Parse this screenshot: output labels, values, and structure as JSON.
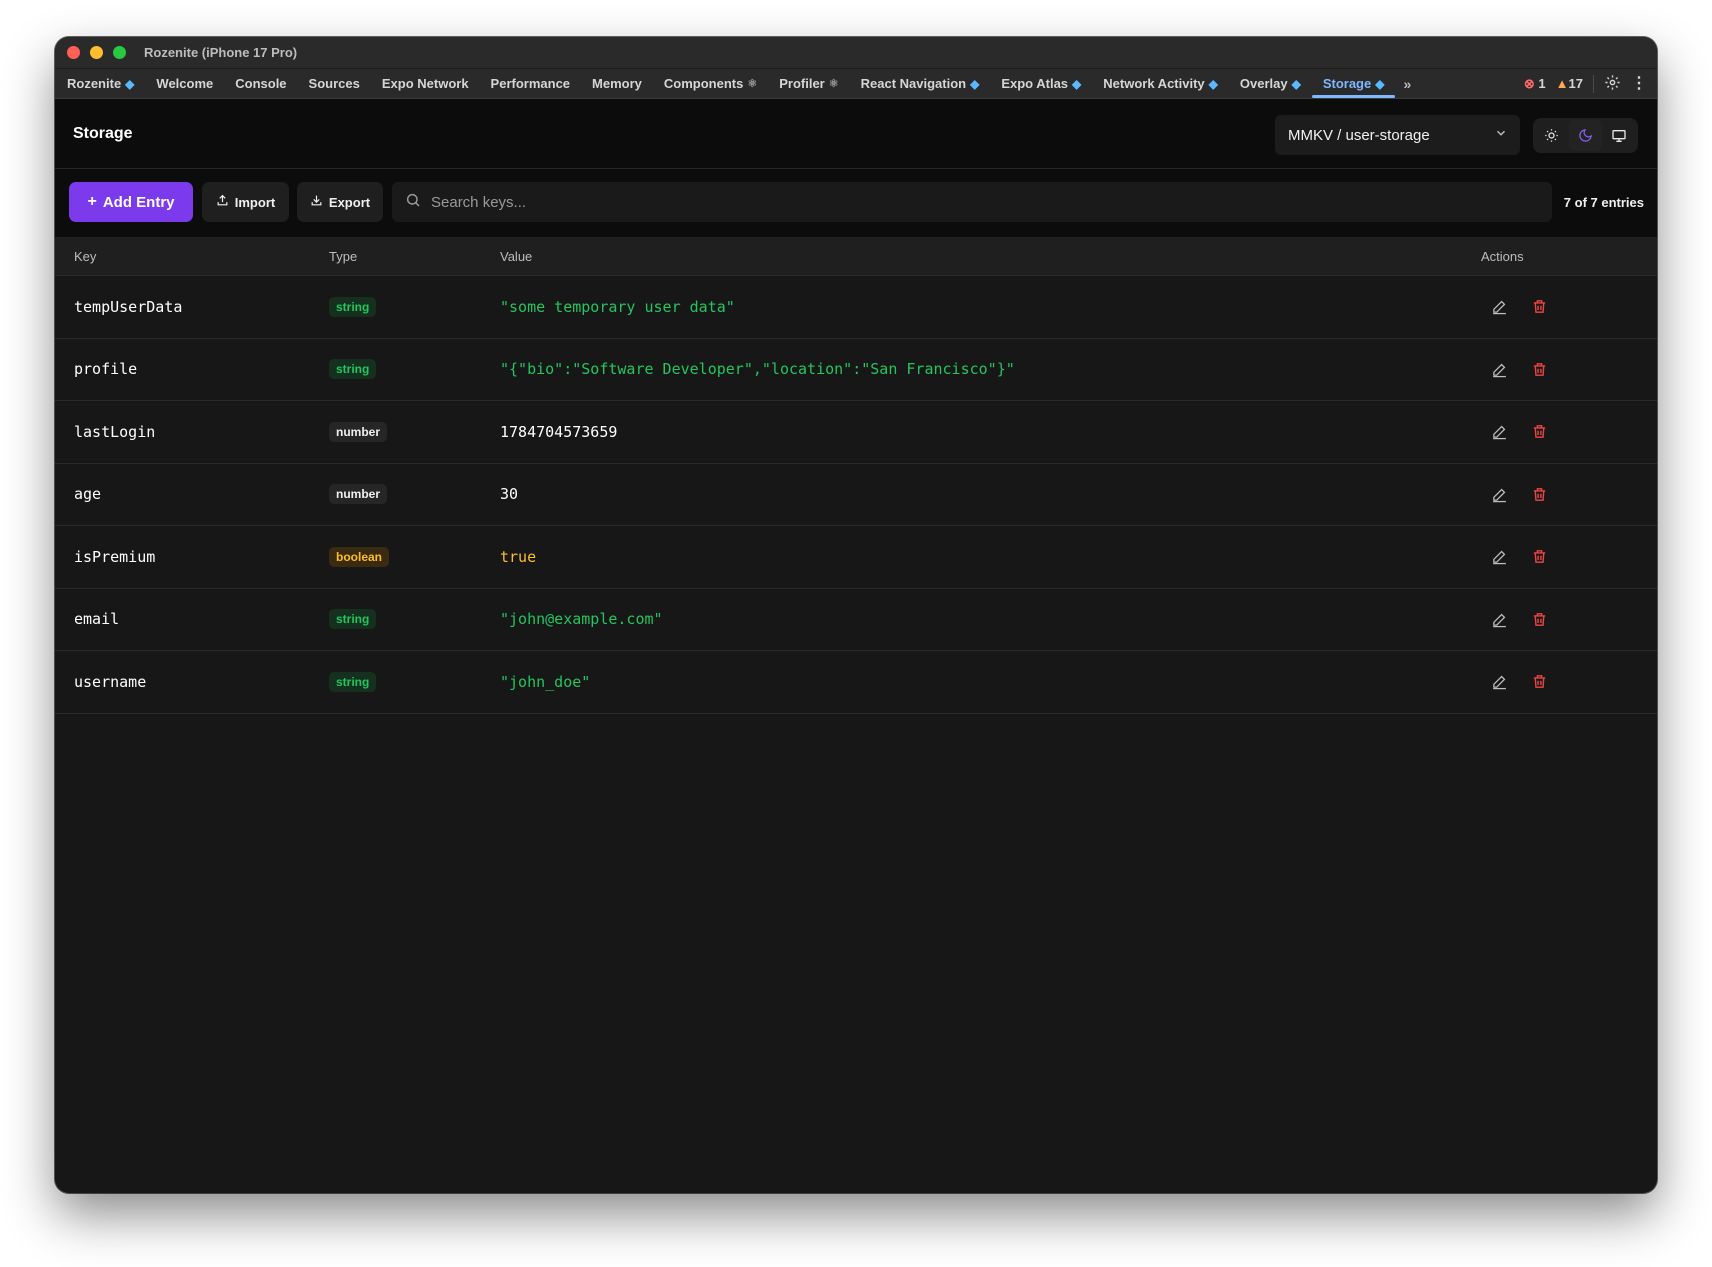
{
  "window": {
    "title": "Rozenite (iPhone 17 Pro)"
  },
  "tabs": [
    {
      "label": "Rozenite",
      "badge": "gem"
    },
    {
      "label": "Welcome"
    },
    {
      "label": "Console"
    },
    {
      "label": "Sources"
    },
    {
      "label": "Expo Network"
    },
    {
      "label": "Performance"
    },
    {
      "label": "Memory"
    },
    {
      "label": "Components",
      "badge": "atom"
    },
    {
      "label": "Profiler",
      "badge": "atom"
    },
    {
      "label": "React Navigation",
      "badge": "gem"
    },
    {
      "label": "Expo Atlas",
      "badge": "gem"
    },
    {
      "label": "Network Activity",
      "badge": "gem"
    },
    {
      "label": "Overlay",
      "badge": "gem"
    },
    {
      "label": "Storage",
      "badge": "gem",
      "active": true
    }
  ],
  "status": {
    "errors": "1",
    "warnings": "17"
  },
  "header": {
    "title": "Storage",
    "storage_selector": "MMKV / user-storage",
    "theme_options": [
      "light",
      "dark",
      "system"
    ],
    "active_theme": "dark"
  },
  "toolbar": {
    "add_label": "Add Entry",
    "import_label": "Import",
    "export_label": "Export",
    "search_placeholder": "Search keys...",
    "entry_count": "7 of 7 entries"
  },
  "table": {
    "columns": {
      "key": "Key",
      "type": "Type",
      "value": "Value",
      "actions": "Actions"
    },
    "rows": [
      {
        "key": "tempUserData",
        "type": "string",
        "value": "\"some temporary user data\""
      },
      {
        "key": "profile",
        "type": "string",
        "value": "\"{\"bio\":\"Software Developer\",\"location\":\"San Francisco\"}\""
      },
      {
        "key": "lastLogin",
        "type": "number",
        "value": "1784704573659"
      },
      {
        "key": "age",
        "type": "number",
        "value": "30"
      },
      {
        "key": "isPremium",
        "type": "boolean",
        "value": "true"
      },
      {
        "key": "email",
        "type": "string",
        "value": "\"john@example.com\""
      },
      {
        "key": "username",
        "type": "string",
        "value": "\"john_doe\""
      }
    ]
  },
  "colors": {
    "accent": "#7c3aed",
    "string": "#22c55e",
    "boolean": "#fbbf24",
    "danger": "#ef4444",
    "active_tab": "#7fb8ff"
  }
}
